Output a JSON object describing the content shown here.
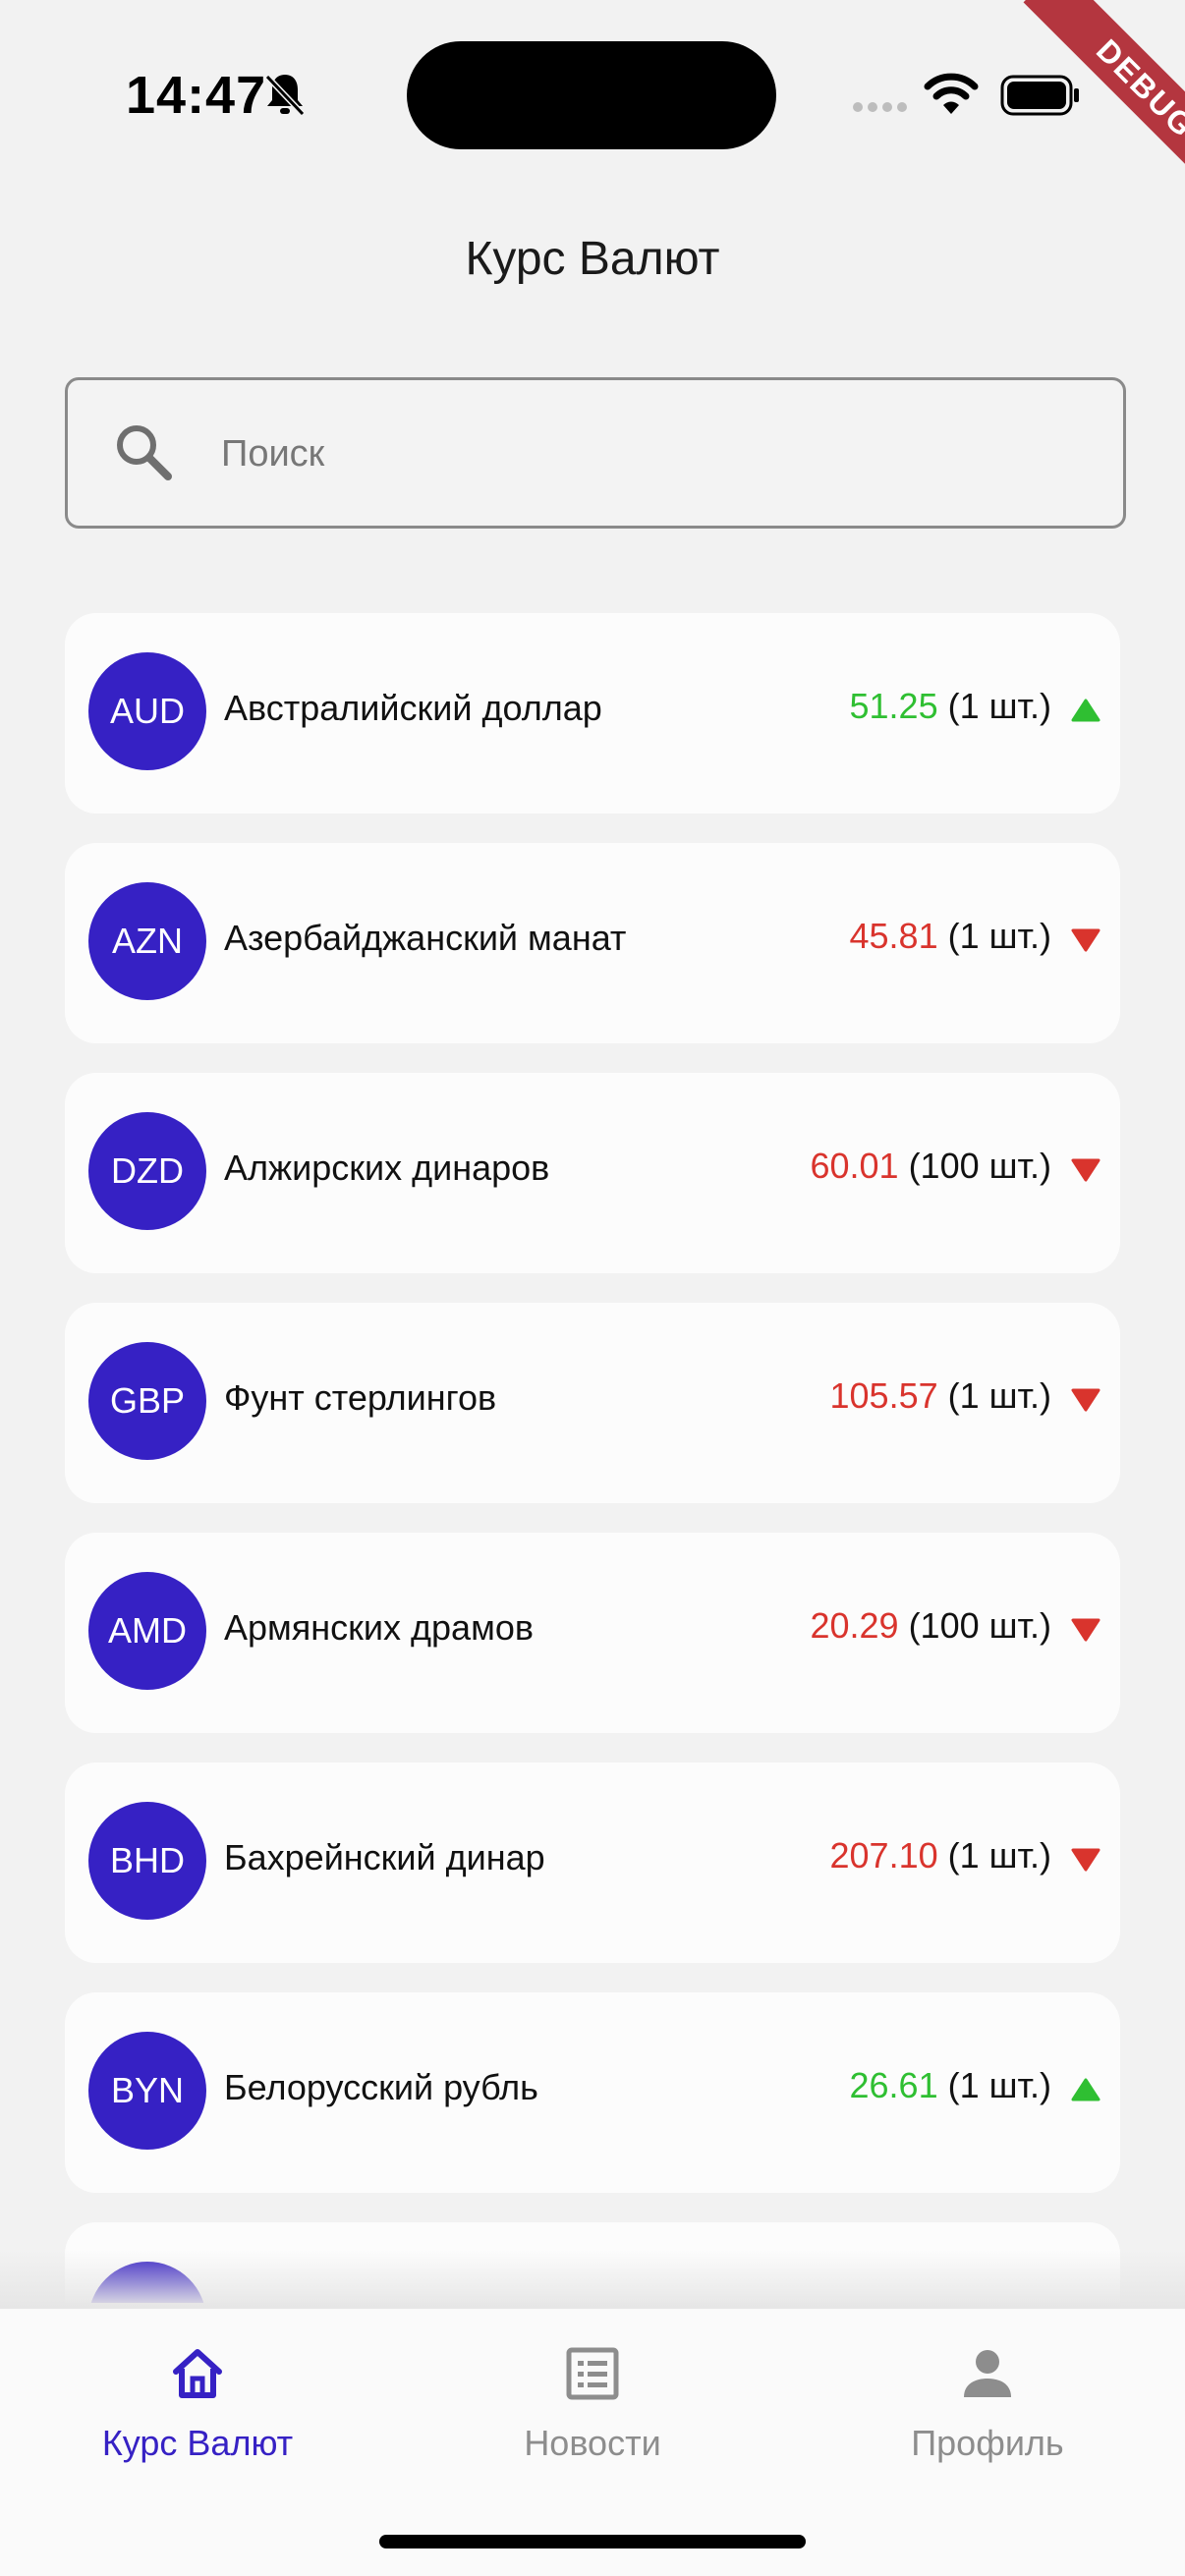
{
  "status": {
    "time": "14:47"
  },
  "debug_label": "DEBUG",
  "header": {
    "title": "Курс Валют"
  },
  "search": {
    "placeholder": "Поиск"
  },
  "colors": {
    "accent": "#3621c4",
    "up": "#2fbf32",
    "down": "#d9342d"
  },
  "currencies": [
    {
      "code": "AUD",
      "name": "Австралийский доллар",
      "rate": "51.25",
      "unit": "(1 шт.)",
      "trend": "up"
    },
    {
      "code": "AZN",
      "name": "Азербайджанский манат",
      "rate": "45.81",
      "unit": "(1 шт.)",
      "trend": "down"
    },
    {
      "code": "DZD",
      "name": "Алжирских динаров",
      "rate": "60.01",
      "unit": "(100 шт.)",
      "trend": "down"
    },
    {
      "code": "GBP",
      "name": "Фунт стерлингов",
      "rate": "105.57",
      "unit": "(1 шт.)",
      "trend": "down"
    },
    {
      "code": "AMD",
      "name": "Армянских драмов",
      "rate": "20.29",
      "unit": "(100 шт.)",
      "trend": "down"
    },
    {
      "code": "BHD",
      "name": "Бахрейнский динар",
      "rate": "207.10",
      "unit": "(1 шт.)",
      "trend": "down"
    },
    {
      "code": "BYN",
      "name": "Белорусский рубль",
      "rate": "26.61",
      "unit": "(1 шт.)",
      "trend": "up"
    }
  ],
  "nav": {
    "rates": {
      "label": "Курс Валют",
      "icon": "home-icon"
    },
    "news": {
      "label": "Новости",
      "icon": "news-icon"
    },
    "profile": {
      "label": "Профиль",
      "icon": "person-icon"
    }
  }
}
